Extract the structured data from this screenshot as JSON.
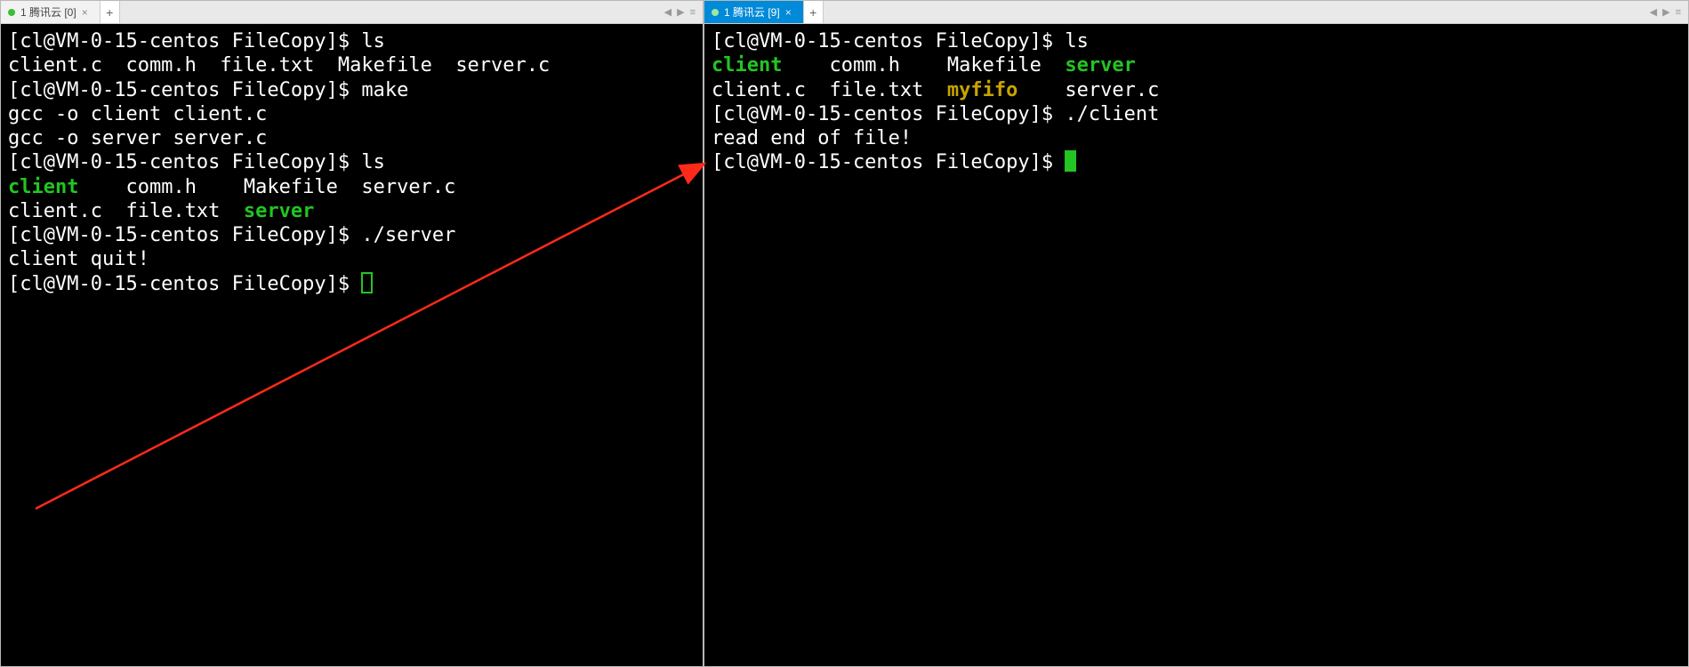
{
  "panes": {
    "left": {
      "tab": {
        "title": "1 腾讯云 [0]"
      },
      "lines": [
        {
          "segs": [
            {
              "t": "[cl@VM-0-15-centos FileCopy]$ ls"
            }
          ]
        },
        {
          "segs": [
            {
              "t": "client.c  comm.h  file.txt  Makefile  server.c"
            }
          ]
        },
        {
          "segs": [
            {
              "t": "[cl@VM-0-15-centos FileCopy]$ make"
            }
          ]
        },
        {
          "segs": [
            {
              "t": "gcc -o client client.c"
            }
          ]
        },
        {
          "segs": [
            {
              "t": "gcc -o server server.c"
            }
          ]
        },
        {
          "segs": [
            {
              "t": "[cl@VM-0-15-centos FileCopy]$ ls"
            }
          ]
        },
        {
          "segs": [
            {
              "t": "client",
              "c": "grn"
            },
            {
              "t": "    comm.h    Makefile  server.c"
            }
          ]
        },
        {
          "segs": [
            {
              "t": "client.c  file.txt  "
            },
            {
              "t": "server",
              "c": "grn"
            }
          ]
        },
        {
          "segs": [
            {
              "t": "[cl@VM-0-15-centos FileCopy]$ ./server"
            }
          ]
        },
        {
          "segs": [
            {
              "t": "client quit!"
            }
          ]
        },
        {
          "segs": [
            {
              "t": "[cl@VM-0-15-centos FileCopy]$ "
            }
          ],
          "cursor": "hollow"
        }
      ]
    },
    "right": {
      "tab": {
        "title": "1 腾讯云 [9]"
      },
      "lines": [
        {
          "segs": [
            {
              "t": "[cl@VM-0-15-centos FileCopy]$ ls"
            }
          ]
        },
        {
          "segs": [
            {
              "t": "client",
              "c": "grn"
            },
            {
              "t": "    comm.h    Makefile  "
            },
            {
              "t": "server",
              "c": "grn"
            }
          ]
        },
        {
          "segs": [
            {
              "t": "client.c  file.txt  "
            },
            {
              "t": "myfifo",
              "c": "yel"
            },
            {
              "t": "    server.c"
            }
          ]
        },
        {
          "segs": [
            {
              "t": "[cl@VM-0-15-centos FileCopy]$ ./client"
            }
          ]
        },
        {
          "segs": [
            {
              "t": "read end of file!"
            }
          ]
        },
        {
          "segs": [
            {
              "t": "[cl@VM-0-15-centos FileCopy]$ "
            }
          ],
          "cursor": "solid"
        }
      ]
    }
  },
  "nav": {
    "prev": "◀",
    "next": "▶",
    "menu": "≡"
  },
  "newtab_label": "+"
}
